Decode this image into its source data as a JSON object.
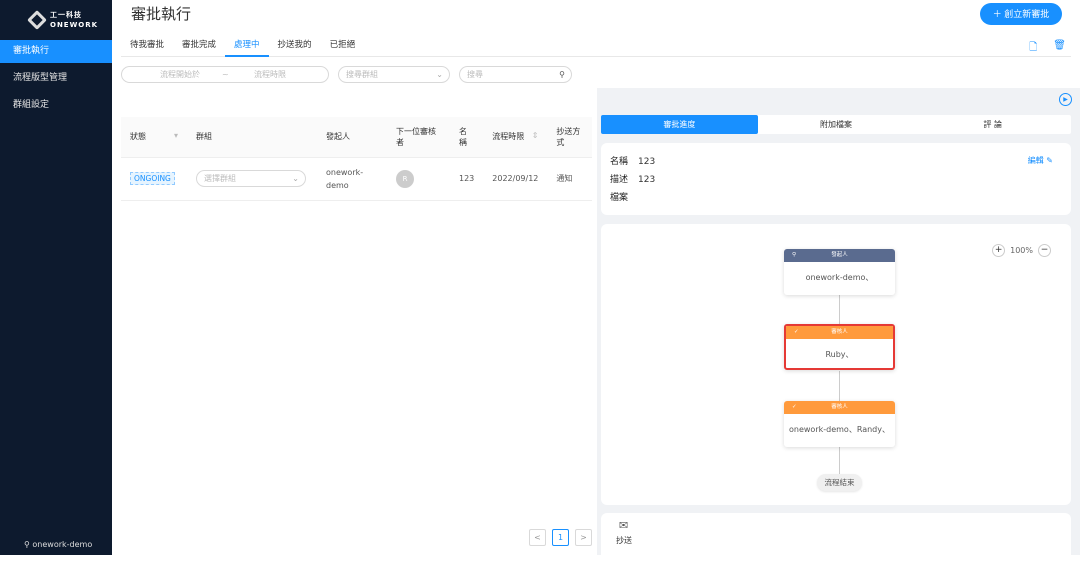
{
  "brand": {
    "name_cn": "工一科技",
    "name_en": "ONEWORK"
  },
  "sidebar": {
    "items": [
      {
        "label": "審批執行",
        "active": true
      },
      {
        "label": "流程版型管理"
      },
      {
        "label": "群組設定"
      }
    ],
    "user": "onework-demo"
  },
  "header": {
    "title": "審批執行",
    "create_label": "創立新審批"
  },
  "tabs": [
    {
      "label": "待我審批"
    },
    {
      "label": "審批完成"
    },
    {
      "label": "處理中",
      "active": true
    },
    {
      "label": "抄送我的"
    },
    {
      "label": "已拒絕"
    }
  ],
  "filters": {
    "start_placeholder": "流程開始於",
    "separator": "~",
    "end_placeholder": "流程時限",
    "group_placeholder": "搜尋群組",
    "search_placeholder": "搜尋"
  },
  "table": {
    "headers": [
      "狀態",
      "群組",
      "發起人",
      "下一位審核者",
      "名稱",
      "流程時限",
      "抄送方式"
    ],
    "rows": [
      {
        "status": "ONGOING",
        "group_placeholder": "選擇群組",
        "initiator": "onework-demo",
        "next_reviewer_initial": "R",
        "name": "123",
        "deadline": "2022/09/12",
        "cc_method": "通知"
      }
    ]
  },
  "pagination": {
    "prev": "<",
    "current": "1",
    "next": ">"
  },
  "detail": {
    "tabs": [
      {
        "label": "審批進度",
        "active": true
      },
      {
        "label": "附加檔案"
      },
      {
        "label": "評 論"
      }
    ],
    "name_label": "名稱",
    "name_value": "123",
    "desc_label": "描述",
    "desc_value": "123",
    "file_label": "檔案",
    "edit_label": "編輯"
  },
  "flow": {
    "zoom": "100%",
    "nodes": [
      {
        "role": "發起人",
        "people": "onework-demo、",
        "color": "#5a6b8f"
      },
      {
        "role": "審核人",
        "people": "Ruby、",
        "color": "#ff9a3c",
        "current": true
      },
      {
        "role": "審核人",
        "people": "onework-demo、Randy、",
        "color": "#ff9a3c"
      }
    ],
    "end_label": "流程結束"
  },
  "cc": {
    "label": "抄送"
  },
  "colors": {
    "primary": "#1890ff",
    "sidebar": "#0d1a2e",
    "current_border": "#e53935"
  }
}
